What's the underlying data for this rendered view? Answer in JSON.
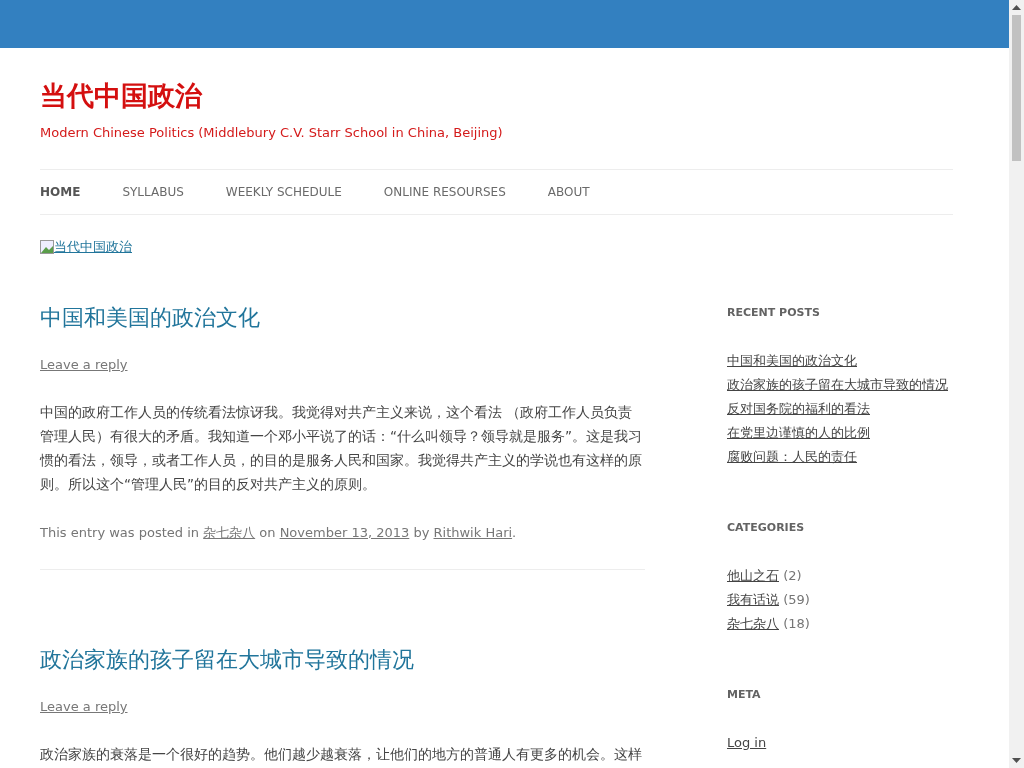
{
  "site": {
    "title": "当代中国政治",
    "tagline": "Modern Chinese Politics (Middlebury C.V. Starr School in China, Beijing)"
  },
  "nav": [
    {
      "label": "HOME",
      "selected": true
    },
    {
      "label": "SYLLABUS",
      "selected": false
    },
    {
      "label": "WEEKLY SCHEDULE",
      "selected": false
    },
    {
      "label": "ONLINE RESOURSES",
      "selected": false
    },
    {
      "label": "ABOUT",
      "selected": false
    }
  ],
  "banner_link": "当代中国政治",
  "posts": [
    {
      "title": "中国和美国的政治文化",
      "reply": "Leave a reply",
      "body": "中国的政府工作人员的传统看法惊讶我。我觉得对共产主义来说，这个看法 （政府工作人员负责管理人民）有很大的矛盾。我知道一个邓小平说了的话：“什么叫领导？领导就是服务”。这是我习惯的看法，领导，或者工作人员，的目的是服务人民和国家。我觉得共产主义的学说也有这样的原则。所以这个“管理人民”的目的反对共产主义的原则。",
      "footer": {
        "prefix": "This entry was posted in",
        "category": "杂七杂八",
        "on": "on",
        "date": "November 13, 2013",
        "by": "by",
        "author": "Rithwik Hari",
        "end": "."
      }
    },
    {
      "title": "政治家族的孩子留在大城市导致的情况",
      "reply": "Leave a reply",
      "body": "政治家族的衰落是一个很好的趋势。他们越少越衰落，让他们的地方的普通人有更多的机会。这样"
    }
  ],
  "sidebar": [
    {
      "heading": "RECENT POSTS",
      "items": [
        {
          "label": "中国和美国的政治文化"
        },
        {
          "label": "政治家族的孩子留在大城市导致的情况"
        },
        {
          "label": "反对国务院的福利的看法"
        },
        {
          "label": "在党里边谨慎的人的比例"
        },
        {
          "label": "腐败问题：人民的责任"
        }
      ]
    },
    {
      "heading": "CATEGORIES",
      "items": [
        {
          "label": "他山之石",
          "count": "(2)"
        },
        {
          "label": "我有话说",
          "count": "(59)"
        },
        {
          "label": "杂七杂八",
          "count": "(18)"
        }
      ]
    },
    {
      "heading": "META",
      "items": [
        {
          "label": "Log in"
        }
      ]
    }
  ]
}
